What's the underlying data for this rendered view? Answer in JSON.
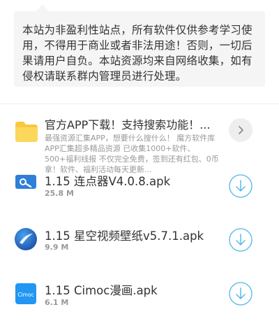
{
  "notice": {
    "text": "本站为非盈利性站点，所有软件仅供参考学习使用，不得用于商业或者非法用途！否则，一切后果请用户自负。本站资源均来自网络收集，如有侵权请联系群内管理员进行处理。"
  },
  "promo": {
    "icon": "folder-icon",
    "title": "官方APP下载！支持搜索功能！...",
    "description": "最强资源汇集APP，想要什么搜什么！ 魔方软件库APP汇集超多精品资源 已收集1000+软件、500+福利线报 不仅完全免费，签到还有红包、0币拿！软件、福利活动每天更新..."
  },
  "apps": [
    {
      "name": "1.15 连点器V4.0.8.apk",
      "size": "25.8 M",
      "icon": "clicker-app-icon"
    },
    {
      "name": "1.15 星空视频壁纸v5.7.1.apk",
      "size": "9.9 M",
      "icon": "starry-wallpaper-app-icon"
    },
    {
      "name": "1.15 Cimoc漫画.apk",
      "size": "6.1 M",
      "icon": "cimoc-app-icon",
      "icon_label": "Cimoc"
    }
  ],
  "colors": {
    "accent": "#4db6e8",
    "folder": "#f9c740"
  }
}
